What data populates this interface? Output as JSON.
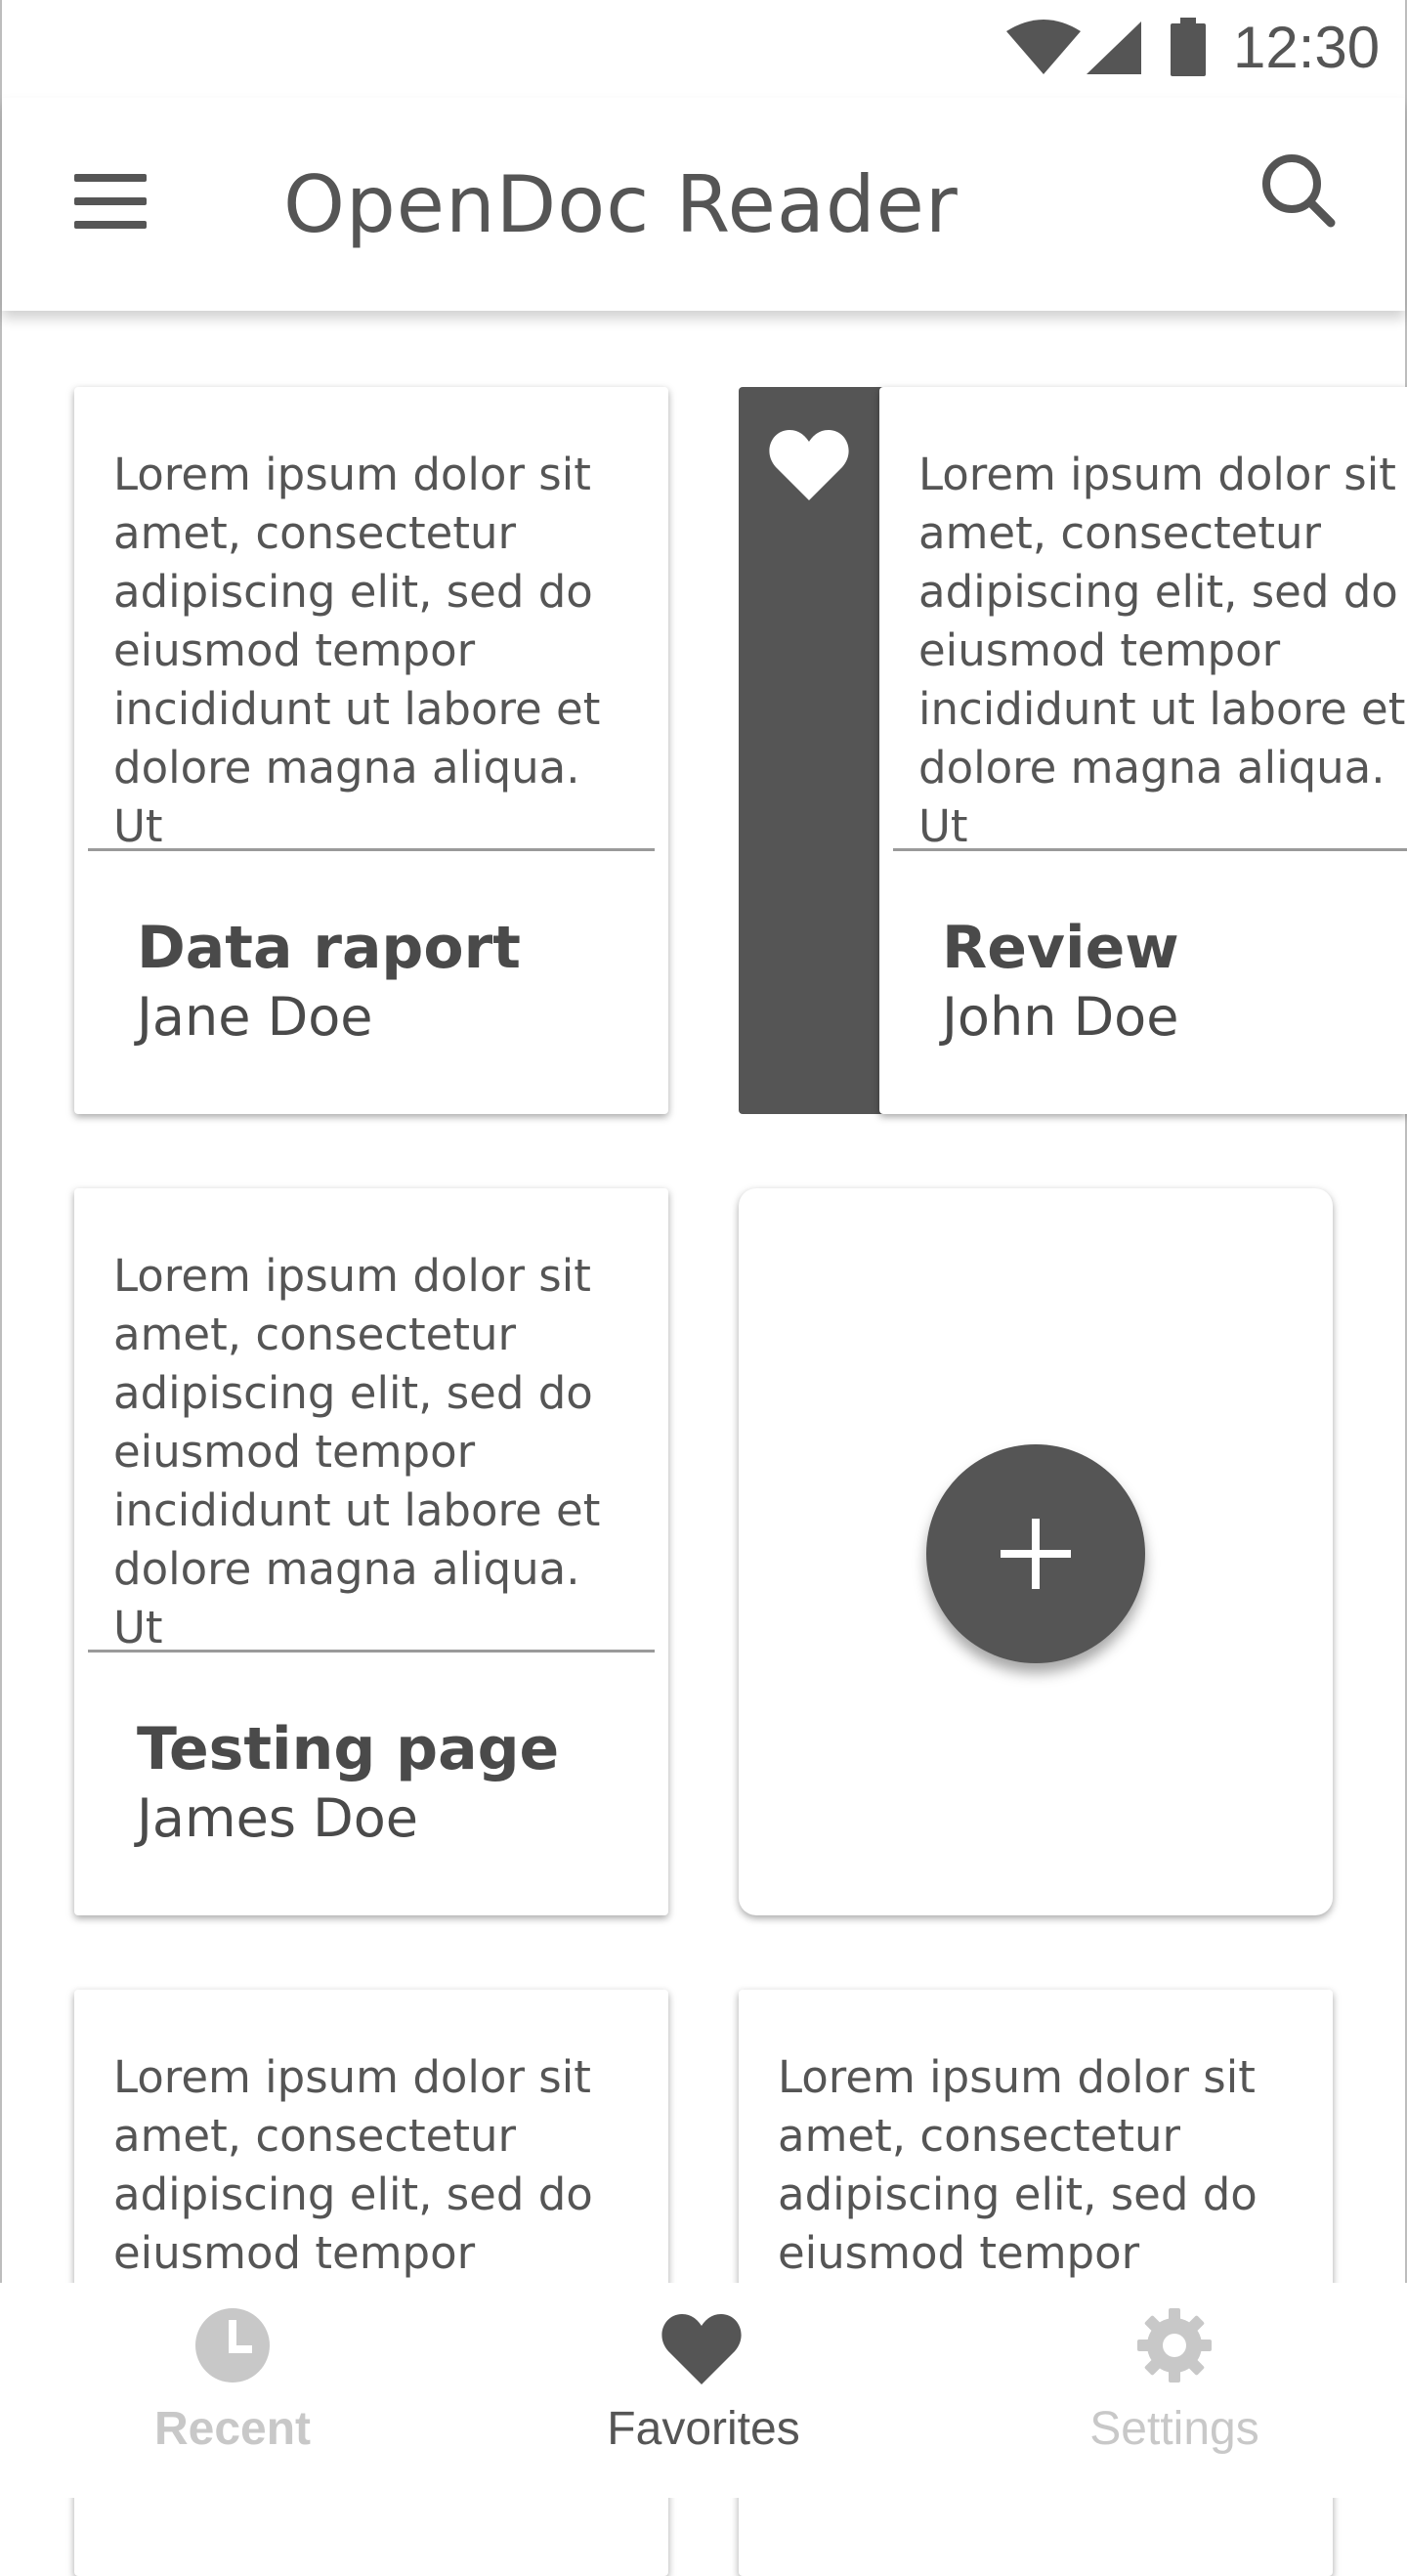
{
  "status_bar": {
    "time": "12:30",
    "icons": [
      "wifi-icon",
      "cell-signal-icon",
      "battery-icon"
    ]
  },
  "app_bar": {
    "title": "OpenDoc Reader",
    "menu_icon": "menu-icon",
    "search_icon": "search-icon"
  },
  "documents": [
    {
      "excerpt": "Lorem ipsum dolor sit amet, consectetur adipiscing elit, sed do eiusmod tempor incididunt ut labore et dolore magna aliqua. Ut",
      "title": "Data raport",
      "author": "Jane Doe",
      "favorite": false
    },
    {
      "excerpt": "Lorem ipsum dolor sit amet, consectetur adipiscing elit, sed do eiusmod tempor incididunt ut labore et dolore magna aliqua. Ut",
      "title": "Review",
      "author": "John Doe",
      "favorite": true
    },
    {
      "excerpt": "Lorem ipsum dolor sit amet, consectetur adipiscing elit, sed do eiusmod tempor incididunt ut labore et dolore magna aliqua. Ut",
      "title": "Testing page",
      "author": "James Doe",
      "favorite": false
    },
    {
      "excerpt": "Lorem ipsum dolor sit amet, consectetur adipiscing elit, sed do eiusmod tempor",
      "title": "",
      "author": "",
      "favorite": false
    },
    {
      "excerpt": "Lorem ipsum dolor sit amet, consectetur adipiscing elit, sed do eiusmod tempor",
      "title": "",
      "author": "",
      "favorite": false
    }
  ],
  "add_button": {
    "icon": "plus-icon"
  },
  "bottom_nav": {
    "items": [
      {
        "label": "Recent",
        "icon": "clock-icon",
        "active": false
      },
      {
        "label": "Favorites",
        "icon": "heart-icon",
        "active": true
      },
      {
        "label": "Settings",
        "icon": "gear-icon",
        "active": false
      }
    ]
  },
  "colors": {
    "primary": "#555555",
    "inactive": "#c8c8c8",
    "background": "#ffffff",
    "divider": "#9a9a9a"
  }
}
